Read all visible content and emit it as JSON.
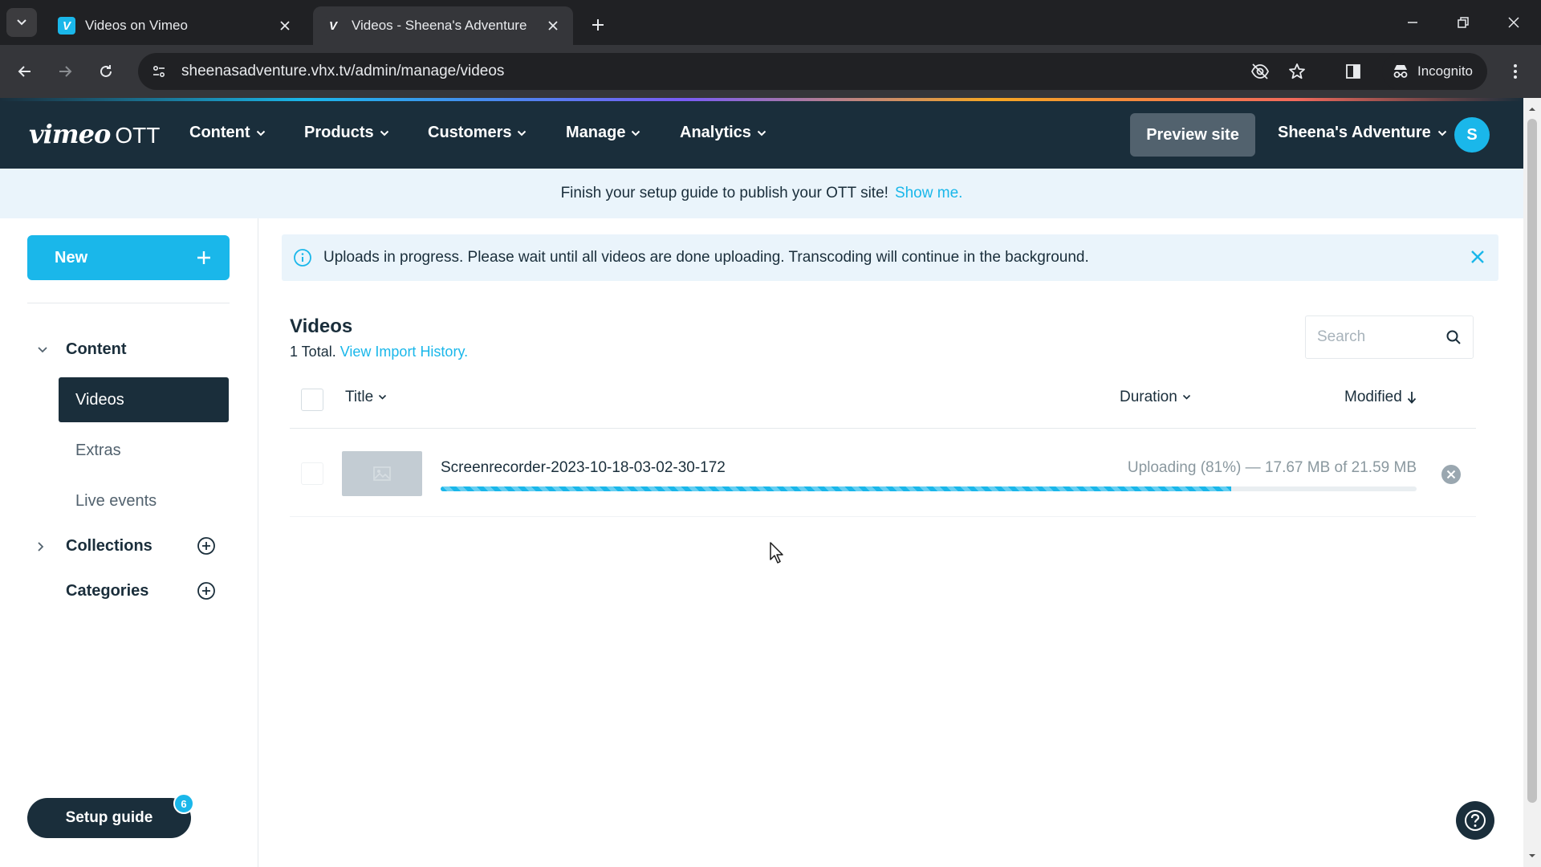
{
  "browser": {
    "tabs": [
      {
        "title": "Videos on Vimeo",
        "favicon": "V",
        "active": false
      },
      {
        "title": "Videos - Sheena's Adventure",
        "favicon": "V",
        "active": true
      }
    ],
    "url": "sheenasadventure.vhx.tv/admin/manage/videos",
    "incognito_label": "Incognito"
  },
  "appnav": {
    "logo_vimeo": "vimeo",
    "logo_ott": "OTT",
    "menus": [
      {
        "label": "Content"
      },
      {
        "label": "Products"
      },
      {
        "label": "Customers"
      },
      {
        "label": "Manage"
      },
      {
        "label": "Analytics"
      }
    ],
    "preview_label": "Preview site",
    "site_name": "Sheena's Adventure",
    "avatar_initial": "S"
  },
  "setup_banner": {
    "text": "Finish your setup guide to publish your OTT site!",
    "link": "Show me."
  },
  "sidebar": {
    "new_label": "New",
    "content_label": "Content",
    "items": [
      {
        "label": "Videos",
        "active": true
      },
      {
        "label": "Extras",
        "active": false
      },
      {
        "label": "Live events",
        "active": false
      }
    ],
    "collections_label": "Collections",
    "categories_label": "Categories",
    "setup_guide_label": "Setup guide",
    "setup_guide_badge": "6"
  },
  "notice": {
    "text": "Uploads in progress. Please wait until all videos are done uploading. Transcoding will continue in the background."
  },
  "videos": {
    "title": "Videos",
    "total_text": "1 Total.",
    "import_history_link": "View Import History.",
    "search_placeholder": "Search",
    "columns": {
      "title": "Title",
      "duration": "Duration",
      "modified": "Modified"
    },
    "rows": [
      {
        "filename": "Screenrecorder-2023-10-18-03-02-30-172",
        "status": "Uploading (81%) — 17.67 MB of 21.59 MB",
        "progress": 0.81
      }
    ]
  },
  "colors": {
    "brand_navy": "#1a2e3b",
    "accent_blue": "#1ab7ea",
    "banner_bg": "#eaf4fb"
  }
}
